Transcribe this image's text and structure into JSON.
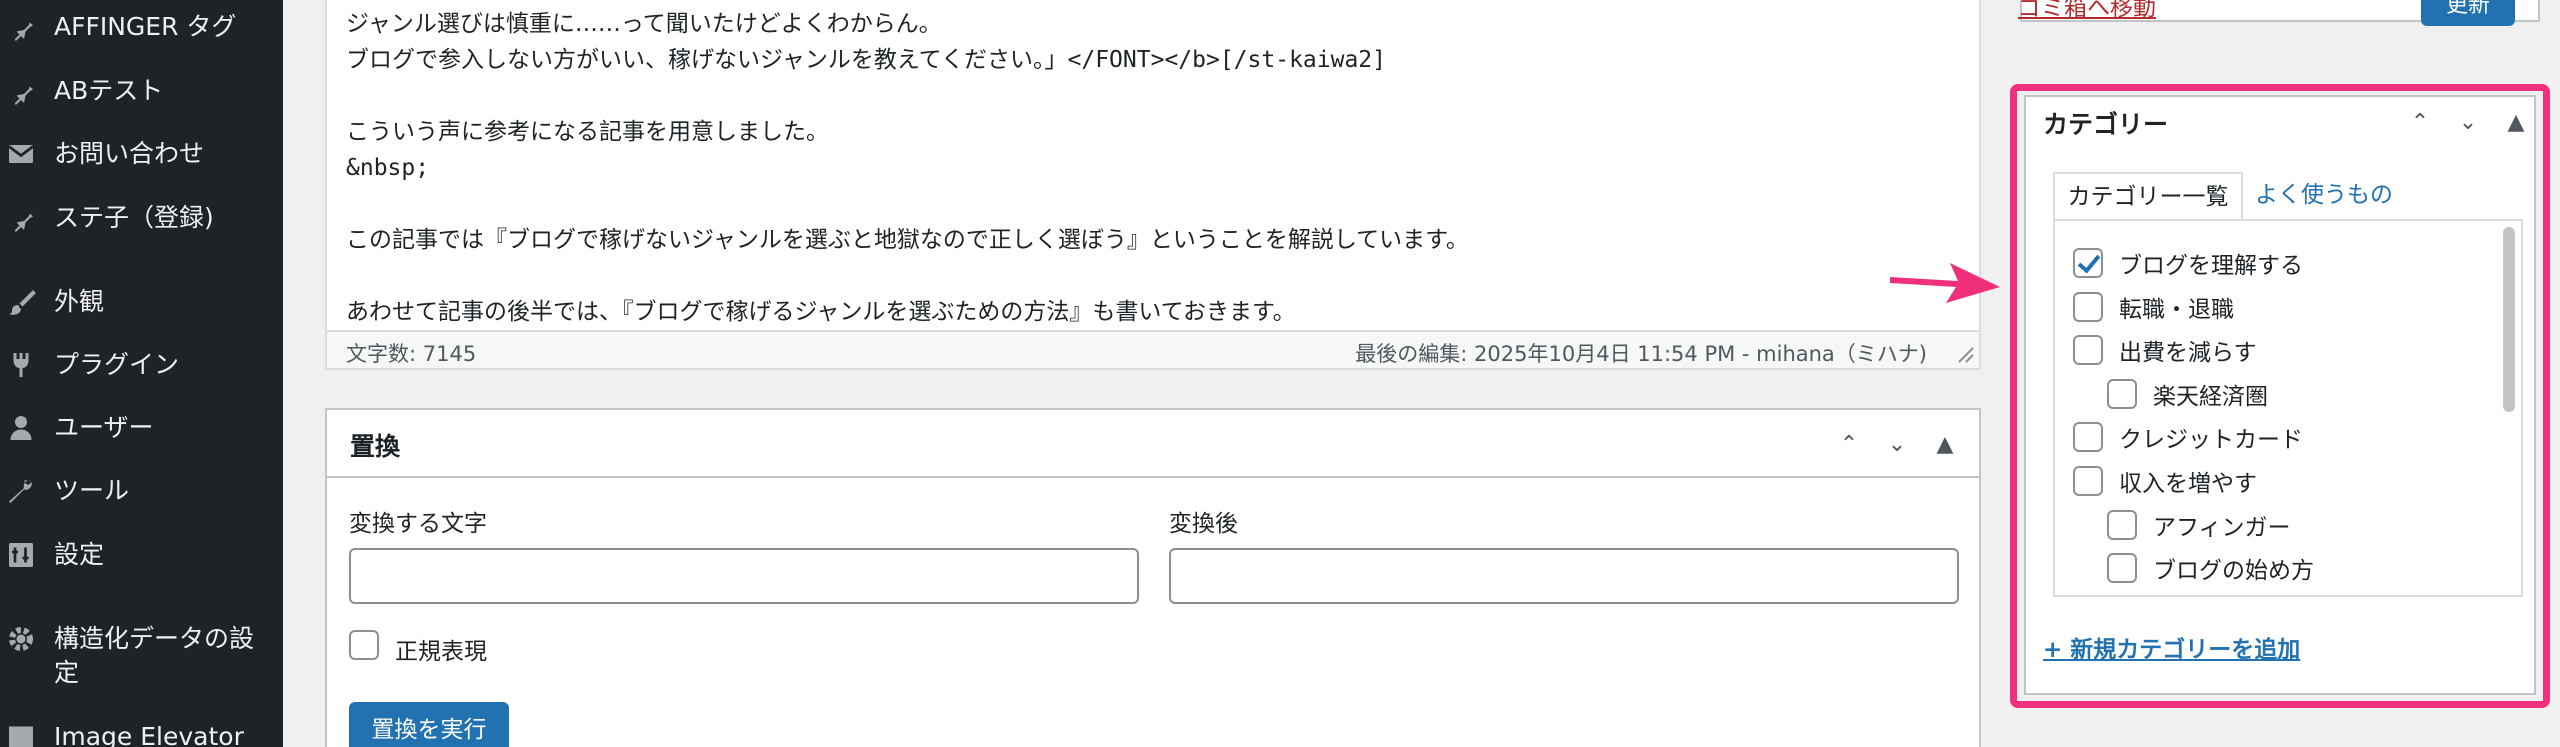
{
  "sidebar": {
    "items": [
      {
        "label": "AFFINGER タグ",
        "icon": "pin-icon"
      },
      {
        "label": "ABテスト",
        "icon": "pin-icon"
      },
      {
        "label": "お問い合わせ",
        "icon": "mail-icon"
      },
      {
        "label": "ステ子（登録)",
        "icon": "pin-icon"
      },
      {
        "label": "外観",
        "icon": "brush-icon"
      },
      {
        "label": "プラグイン",
        "icon": "plugin-icon"
      },
      {
        "label": "ユーザー",
        "icon": "user-icon"
      },
      {
        "label": "ツール",
        "icon": "wrench-icon"
      },
      {
        "label": "設定",
        "icon": "settings-icon"
      },
      {
        "label": "構造化データの設定",
        "icon": "gear-icon"
      },
      {
        "label": "Image Elevator",
        "icon": "image-icon"
      }
    ]
  },
  "editor": {
    "lines": [
      "ジャンル選びは慎重に……って聞いたけどよくわからん。",
      "ブログで参入しない方がいい、稼げないジャンルを教えてください。」</FONT></b>[/st-kaiwa2]",
      "",
      "こういう声に参考になる記事を用意しました。",
      "&nbsp;",
      "",
      "この記事では『ブログで稼げないジャンルを選ぶと地獄なので正しく選ぼう』ということを解説しています。",
      "",
      "あわせて記事の後半では、『ブログで稼げるジャンルを選ぶための方法』も書いておきます。"
    ],
    "word_count": "文字数: 7145",
    "last_edit": "最後の編集: 2025年10月4日 11:54 PM - mihana（ミハナ)"
  },
  "replace": {
    "title": "置換",
    "from_label": "変換する文字",
    "to_label": "変換後",
    "from_value": "",
    "to_value": "",
    "regex_label": "正規表現",
    "regex_checked": false,
    "run_label": "置換を実行"
  },
  "publish": {
    "trash_label": "ゴミ箱へ移動",
    "update_label": "更新"
  },
  "category": {
    "title": "カテゴリー",
    "tab_all": "カテゴリー一覧",
    "tab_popular": "よく使うもの",
    "items": [
      {
        "label": "ブログを理解する",
        "checked": true,
        "indent": 0
      },
      {
        "label": "転職・退職",
        "checked": false,
        "indent": 0
      },
      {
        "label": "出費を減らす",
        "checked": false,
        "indent": 0
      },
      {
        "label": "楽天経済圏",
        "checked": false,
        "indent": 1
      },
      {
        "label": "クレジットカード",
        "checked": false,
        "indent": 0
      },
      {
        "label": "収入を増やす",
        "checked": false,
        "indent": 0
      },
      {
        "label": "アフィンガー",
        "checked": false,
        "indent": 1
      },
      {
        "label": "ブログの始め方",
        "checked": false,
        "indent": 1
      }
    ],
    "add_label": "+ 新規カテゴリーを追加"
  },
  "colors": {
    "sidebar_bg": "#1d2327",
    "accent": "#2271b1",
    "highlight": "#f0307a",
    "trash": "#b32d2e"
  }
}
